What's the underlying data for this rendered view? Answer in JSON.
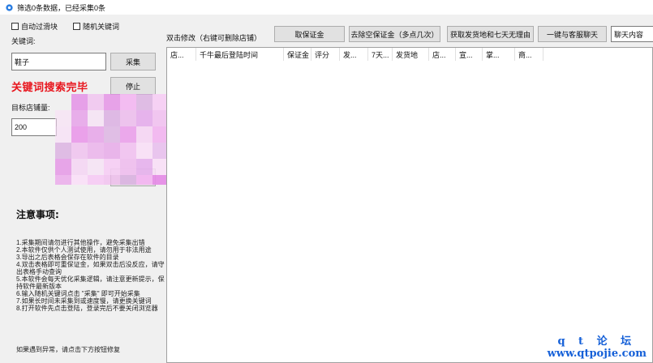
{
  "window": {
    "title": "筛选0条数据，已经采集0条",
    "icon": "gear-icon"
  },
  "left": {
    "auto_slider_label": "自动过滑块",
    "random_keyword_label": "随机关键词",
    "keyword_label": "关键词:",
    "keyword_value": "鞋子",
    "collect_button": "采集",
    "status_text": "关键词搜索完毕",
    "stop_button": "停止",
    "target_store_label": "目标店铺量:",
    "target_store_value": "200",
    "notes_title": "注意事项:",
    "notes": [
      "1.采集期间请勿进行其他操作，避免采集出错",
      "2.本软件仅供个人测试使用，请勿用于非法用途",
      "3.导出之后表格会保存在软件的目录",
      "4.双击表格即可重保证金，如果双击后没反应，请守出表格手动查询",
      "5.本软件会每天优化采集逻辑，请注意更新提示，保持软件最新版本",
      "6.输入随机关键词点击 \"采集\" 即可开始采集",
      "7.如果长时间未采集到或速度慢，请更换关键词",
      "8.打开软件先点击登陆，登录完后不要关闭浏览器"
    ],
    "footer_note": "如果遇到异常，请点击下方按钮修复"
  },
  "toolbar": {
    "hint": "双击修改（右键可删除店铺）",
    "get_deposit": "取保证金",
    "remove_empty_deposit": "去除空保证金（多点几次）",
    "get_ship_return": "获取发货地和七天无理由",
    "one_click_chat": "一键与客服聊天",
    "chat_content": "聊天内容"
  },
  "grid": {
    "columns": [
      "店...",
      "千牛最后登陆时间",
      "保证金",
      "评分",
      "发...",
      "7天...",
      "发货地",
      "店...",
      "宣...",
      "掌...",
      "商..."
    ]
  },
  "watermark": {
    "line1": "q t 论 坛",
    "line2": "www.qtpojie.com"
  },
  "colors": {
    "status_red": "#e8141c",
    "watermark_blue": "#1560d8"
  }
}
